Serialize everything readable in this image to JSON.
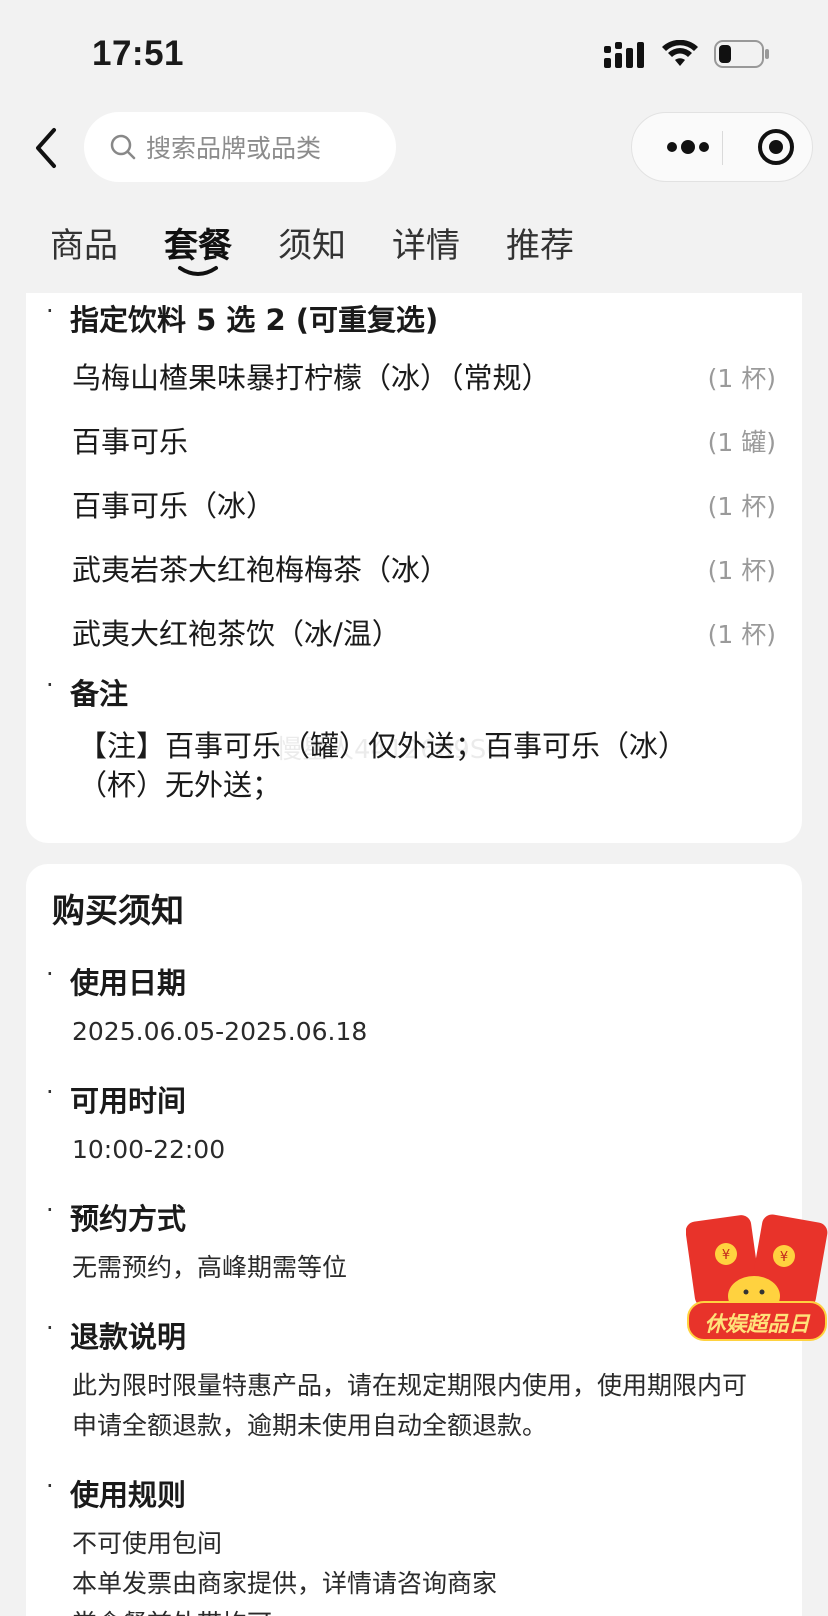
{
  "status_bar": {
    "time": "17:51"
  },
  "search": {
    "placeholder": "搜索品牌或品类"
  },
  "tabs": [
    {
      "label": "商品",
      "active": false
    },
    {
      "label": "套餐",
      "active": true
    },
    {
      "label": "须知",
      "active": false
    },
    {
      "label": "详情",
      "active": false
    },
    {
      "label": "推荐",
      "active": false
    }
  ],
  "package": {
    "drinks_title": "指定饮料 5 选 2 (可重复选)",
    "drinks": [
      {
        "name": "乌梅山楂果味暴打柠檬（冰）（常规）",
        "qty": "(1 杯)"
      },
      {
        "name": "百事可乐",
        "qty": "(1 罐)"
      },
      {
        "name": "百事可乐（冰）",
        "qty": "(1 杯)"
      },
      {
        "name": "武夷岩茶大红袍梅梅茶（冰）",
        "qty": "(1 杯)"
      },
      {
        "name": "武夷大红袍茶饮（冰/温）",
        "qty": "(1 杯)"
      }
    ],
    "note_title": "备注",
    "note_line1": "【注】百事可乐（罐）仅外送；百事可乐（冰）",
    "note_line2": "（杯）无外送；",
    "watermark": "慢星人4412609SG"
  },
  "notice": {
    "title": "购买须知",
    "sections": [
      {
        "title": "使用日期",
        "value": "2025.06.05-2025.06.18"
      },
      {
        "title": "可用时间",
        "value": "10:00-22:00"
      },
      {
        "title": "预约方式",
        "value": "无需预约，高峰期需等位"
      },
      {
        "title": "退款说明",
        "value_line1": "此为限时限量特惠产品，请在规定期限内使用，使用期限内可",
        "value_line2": "申请全额退款，逾期未使用自动全额退款。"
      },
      {
        "title": "使用规则",
        "value_line1": "不可使用包间",
        "value_line2": "本单发票由商家提供，详情请咨询商家",
        "value_line3": "堂食餐前外带均可"
      }
    ]
  },
  "promo": {
    "label": "休娱超品日",
    "colors": {
      "red": "#e8332a",
      "yellow": "#ffd23f"
    }
  },
  "colors": {
    "background": "#f2f2f2",
    "card": "#ffffff",
    "muted": "#9a9a9a"
  }
}
